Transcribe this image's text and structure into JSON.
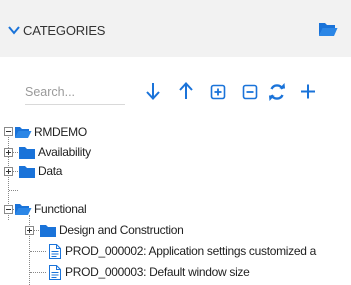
{
  "header": {
    "title": "CATEGORIES"
  },
  "search": {
    "placeholder": "Search..."
  },
  "colors": {
    "accent": "#1a73d9",
    "header_bg": "#f2f2f2"
  },
  "toolbar": {
    "icons": [
      "arrow-down-icon",
      "arrow-up-icon",
      "expand-all-icon",
      "collapse-all-icon",
      "refresh-icon",
      "add-icon"
    ]
  },
  "tree": {
    "root": "RMDEMO",
    "availability": "Availability",
    "data": "Data",
    "functional": "Functional",
    "design": "Design and Construction",
    "req1": "PROD_000002: Application settings customized a",
    "req2": "PROD_000003: Default window size"
  }
}
